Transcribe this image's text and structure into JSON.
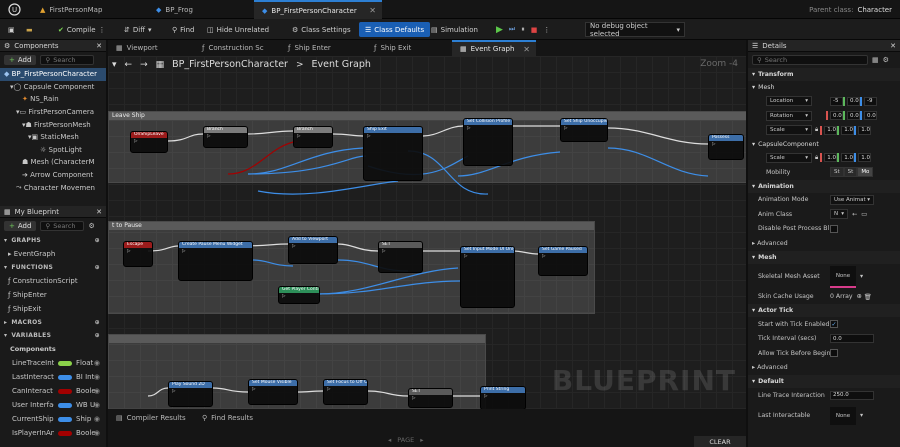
{
  "tabs": [
    {
      "label": "FirstPersonMap"
    },
    {
      "label": "BP_Frog"
    },
    {
      "label": "BP_FirstPersonCharacter"
    }
  ],
  "parent_class": {
    "label": "Parent class:",
    "value": "Character"
  },
  "toolbar": {
    "compile": "Compile",
    "diff": "Diff",
    "find": "Find",
    "hide_unrelated": "Hide Unrelated",
    "class_settings": "Class Settings",
    "class_defaults": "Class Defaults",
    "simulation": "Simulation",
    "debug_object": "No debug object selected"
  },
  "components_panel": {
    "title": "Components",
    "add": "Add",
    "search_placeholder": "Search",
    "items": [
      {
        "label": "BP_FirstPersonCharacter"
      },
      {
        "label": "Capsule Component"
      },
      {
        "label": "NS_Rain"
      },
      {
        "label": "FirstPersonCamera"
      },
      {
        "label": "FirstPersonMesh"
      },
      {
        "label": "StaticMesh"
      },
      {
        "label": "SpotLight"
      },
      {
        "label": "Mesh (CharacterM"
      },
      {
        "label": "Arrow Component"
      },
      {
        "label": "Character Movemen"
      }
    ]
  },
  "blueprint_panel": {
    "title": "My Blueprint",
    "add": "Add",
    "search_placeholder": "Search",
    "sections": {
      "graphs": "GRAPHS",
      "functions": "FUNCTIONS",
      "macros": "MACROS",
      "variables": "VARIABLES",
      "components": "Components"
    },
    "graphs": [
      {
        "label": "EventGraph"
      }
    ],
    "functions": [
      {
        "label": "ConstructionScript"
      },
      {
        "label": "ShipEnter"
      },
      {
        "label": "ShipExit"
      }
    ],
    "variables": [
      {
        "name": "LineTraceInte",
        "type": "Float",
        "color": "#8bd14a"
      },
      {
        "name": "LastInteracta",
        "type": "BI Int",
        "color": "#3d8ee8"
      },
      {
        "name": "CanInteract",
        "type": "Boole",
        "color": "#a30000"
      },
      {
        "name": "User Interfac",
        "type": "WB U",
        "color": "#3d8ee8"
      },
      {
        "name": "CurrentShip",
        "type": "Ship",
        "color": "#3d8ee8"
      },
      {
        "name": "IsPlayerInAny",
        "type": "Boole",
        "color": "#a30000"
      }
    ]
  },
  "graph_tabs": {
    "viewport": "Viewport",
    "construction": "Construction Sc",
    "ship_enter": "Ship Enter",
    "ship_exit": "Ship Exit",
    "event_graph": "Event Graph"
  },
  "graph_header": {
    "blueprint": "BP_FirstPersonCharacter",
    "separator": ">",
    "graph": "Event Graph",
    "zoom": "Zoom -4"
  },
  "graph": {
    "comments": [
      {
        "label": "Leave Ship"
      },
      {
        "label": "t to Pause"
      },
      {
        "label": ""
      }
    ],
    "nodes": [
      {
        "title": "OnShipLeave",
        "color": "#9b1b1b"
      },
      {
        "title": "Branch",
        "color": "#7c7c7c"
      },
      {
        "title": "Branch",
        "color": "#7c7c7c"
      },
      {
        "title": "Ship Exit",
        "color": "#3d6ea8"
      },
      {
        "title": "Set Collision Profile Name",
        "color": "#3d6ea8"
      },
      {
        "title": "Set Ship Unoccupied",
        "color": "#3d6ea8"
      },
      {
        "title": "Possess",
        "color": "#3d6ea8"
      },
      {
        "title": "Escape",
        "color": "#9b1b1b"
      },
      {
        "title": "Create Pause Menu Widget",
        "color": "#3d6ea8"
      },
      {
        "title": "Add to Viewport",
        "color": "#3d6ea8"
      },
      {
        "title": "SET",
        "color": "#5a5a5a"
      },
      {
        "title": "Set Input Mode UI Only",
        "color": "#3d6ea8"
      },
      {
        "title": "Set Game Paused",
        "color": "#3d6ea8"
      },
      {
        "title": "Get Player Controller",
        "color": "#2d8f59"
      },
      {
        "title": "Play Sound 2D",
        "color": "#3d6ea8"
      },
      {
        "title": "Set Mouse Visible",
        "color": "#3d6ea8"
      },
      {
        "title": "Set Focus to Off Challenge",
        "color": "#3d6ea8"
      },
      {
        "title": "SET",
        "color": "#5a5a5a"
      },
      {
        "title": "Print String",
        "color": "#3d6ea8"
      }
    ],
    "watermark": "BLUEPRINT"
  },
  "bottom_tabs": {
    "compiler": "Compiler Results",
    "find": "Find Results",
    "page": "PAGE",
    "clear": "CLEAR"
  },
  "details": {
    "title": "Details",
    "search_placeholder": "Search",
    "transform": "Transform",
    "mesh_sub": "Mesh",
    "location": {
      "label": "Location",
      "x": "-5",
      "y": "0.0",
      "z": "-9"
    },
    "rotation": {
      "label": "Rotation",
      "x": "0.0",
      "y": "0.0",
      "z": "0.0"
    },
    "scale": {
      "label": "Scale",
      "x": "1.0",
      "y": "1.0",
      "z": "1.0"
    },
    "capsule": "CapsuleComponent",
    "capsule_scale": {
      "label": "Scale",
      "x": "1.0",
      "y": "1.0",
      "z": "1.0"
    },
    "mobility": {
      "label": "Mobility",
      "options": [
        "St",
        "St",
        "Mo"
      ]
    },
    "animation": "Animation",
    "anim_mode": {
      "label": "Animation Mode",
      "value": "Use Animat"
    },
    "anim_class": {
      "label": "Anim Class",
      "value": "N"
    },
    "disable_post": {
      "label": "Disable Post Process Bl"
    },
    "advanced": "Advanced",
    "mesh": "Mesh",
    "skeletal": {
      "label": "Skeletal Mesh Asset",
      "value": "None"
    },
    "skin_cache": {
      "label": "Skin Cache Usage",
      "value": "0 Array"
    },
    "actor_tick": "Actor Tick",
    "start_tick": {
      "label": "Start with Tick Enabled"
    },
    "tick_interval": {
      "label": "Tick Interval (secs)",
      "value": "0.0"
    },
    "allow_tick": {
      "label": "Allow Tick Before Begin"
    },
    "advanced2": "Advanced",
    "default": "Default",
    "line_trace": {
      "label": "Line Trace Interaction",
      "value": "250.0"
    },
    "last_interactable": {
      "label": "Last Interactable",
      "value": "None"
    }
  }
}
